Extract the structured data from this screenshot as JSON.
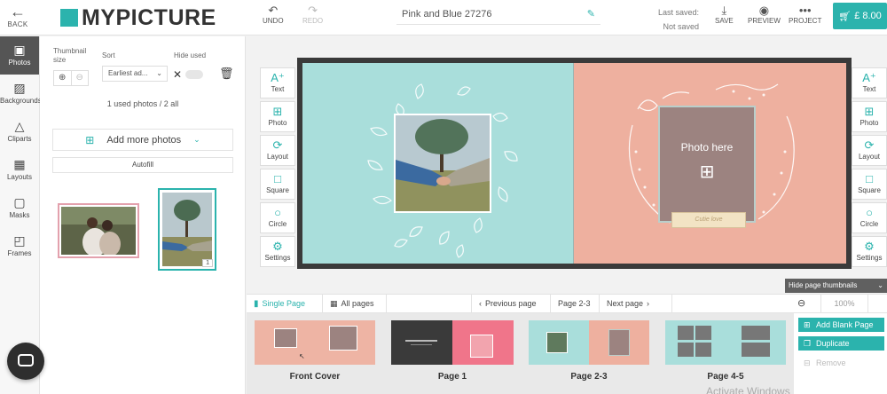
{
  "topbar": {
    "back_label": "BACK",
    "logo_text": "MYPICTURE",
    "undo_label": "UNDO",
    "redo_label": "REDO",
    "project_title": "Pink and Blue 27276",
    "last_saved_label": "Last saved:",
    "last_saved_value": "Not saved",
    "save_label": "SAVE",
    "preview_label": "PREVIEW",
    "project_label": "PROJECT",
    "cart_price": "£ 8.00"
  },
  "rail": {
    "items": [
      {
        "label": "Photos",
        "icon": "photo-icon"
      },
      {
        "label": "Backgrounds",
        "icon": "background-icon"
      },
      {
        "label": "Cliparts",
        "icon": "shapes-icon"
      },
      {
        "label": "Layouts",
        "icon": "layout-icon"
      },
      {
        "label": "Masks",
        "icon": "mask-icon"
      },
      {
        "label": "Frames",
        "icon": "frame-icon"
      }
    ]
  },
  "panel": {
    "thumb_size_label": "Thumbnail size",
    "sort_label": "Sort",
    "sort_value": "Earliest ad...",
    "hide_used_label": "Hide used",
    "used_count": "1 used photos / 2 all",
    "add_more_label": "Add more photos",
    "autofill_label": "Autofill",
    "thumb2_badge": "1"
  },
  "canvas": {
    "tools_left": [
      "Text",
      "Photo",
      "Layout",
      "Square",
      "Circle",
      "Settings"
    ],
    "tools_right": [
      "Text",
      "Photo",
      "Layout",
      "Square",
      "Circle",
      "Settings"
    ],
    "photo_placeholder": "Photo here",
    "ribbon_text": "Cutie love"
  },
  "controls": {
    "single_page": "Single Page",
    "all_pages": "All pages",
    "previous_page": "Previous page",
    "current_page": "Page 2-3",
    "next_page": "Next page",
    "hide_thumbnails": "Hide page thumbnails",
    "zoom_value": "100%"
  },
  "thumbnails": [
    {
      "label": "Front Cover"
    },
    {
      "label": "Page 1"
    },
    {
      "label": "Page 2-3"
    },
    {
      "label": "Page 4-5"
    }
  ],
  "side_actions": {
    "add_blank": "Add Blank Page",
    "duplicate": "Duplicate",
    "remove": "Remove"
  },
  "watermark": "Activate Windows",
  "colors": {
    "accent": "#2bb3ad",
    "page_left": "#a9dedb",
    "page_right": "#eeb09f",
    "placeholder": "#9c8380"
  }
}
